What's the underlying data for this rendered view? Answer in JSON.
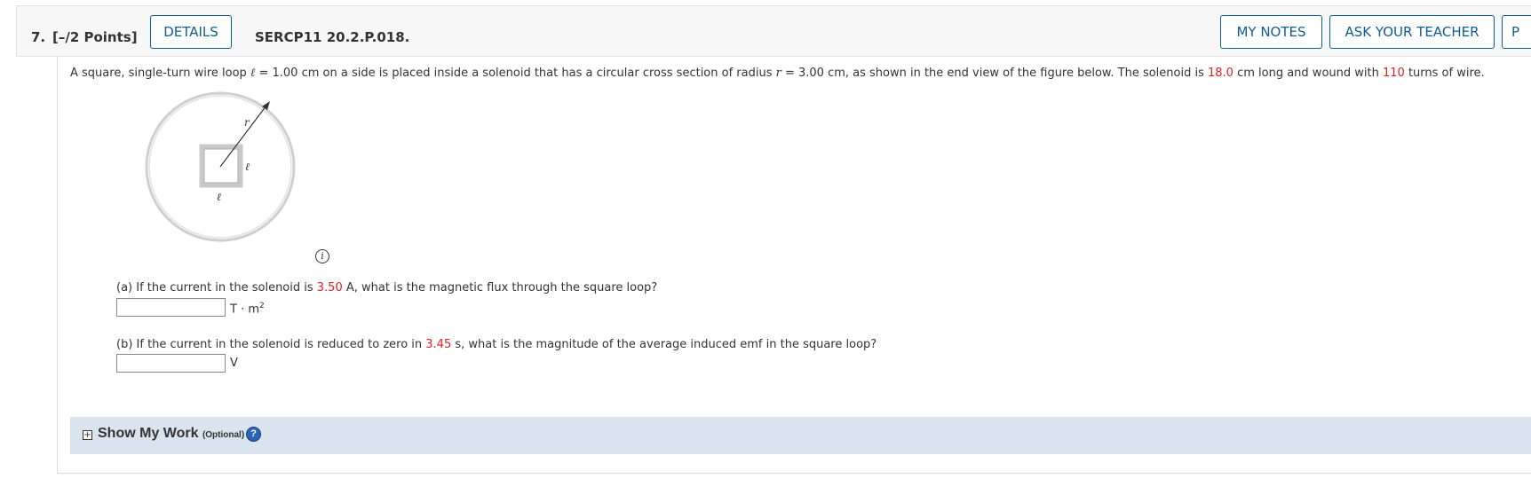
{
  "header": {
    "question_number": "7.",
    "points": "[–/2 Points]",
    "details_label": "DETAILS",
    "problem_code": "SERCP11 20.2.P.018.",
    "my_notes_label": "MY NOTES",
    "ask_teacher_label": "ASK YOUR TEACHER",
    "next_button_partial": "P"
  },
  "problem": {
    "text_1": "A square, single-turn wire loop ",
    "ell": "ℓ",
    "text_2": " = 1.00 cm on a side is placed inside a solenoid that has a circular cross section of radius ",
    "r": "r",
    "text_3": " = 3.00 cm, as shown in the end view of the figure below. The solenoid is ",
    "length_value": "18.0",
    "text_4": " cm long and wound with ",
    "turns_value": "110",
    "text_5": " turns of wire."
  },
  "figure": {
    "label_r": "r",
    "label_ell_side": "ℓ",
    "label_ell_bottom": "ℓ",
    "info_icon": "i"
  },
  "part_a": {
    "prefix": "(a) If the current in the solenoid is ",
    "current_value": "3.50",
    "suffix": " A, what is the magnetic flux through the square loop?",
    "answer_value": "",
    "unit": "T · m",
    "unit_exp": "2"
  },
  "part_b": {
    "prefix": "(b) If the current in the solenoid is reduced to zero in ",
    "time_value": "3.45",
    "suffix": " s, what is the magnitude of the average induced emf in the square loop?",
    "answer_value": "",
    "unit": "V"
  },
  "show_my_work": {
    "expand_icon": "+",
    "title": "Show My Work ",
    "optional": "(Optional)",
    "help_icon": "?"
  },
  "colors": {
    "accent_blue": "#0f5c94",
    "given_value_red": "#e02020",
    "show_work_bg": "#d9e4ee"
  }
}
